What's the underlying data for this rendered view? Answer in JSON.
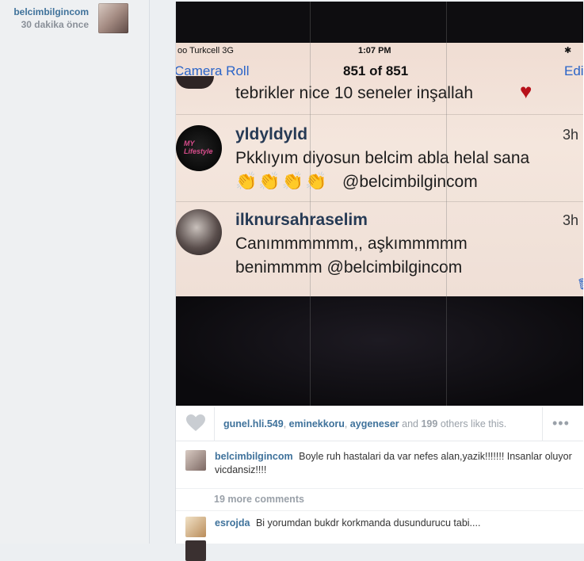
{
  "author": {
    "username": "belcimbilgincom",
    "time_ago": "30 dakika önce",
    "avatar_icon": "profile-photo"
  },
  "photo_screenshot": {
    "status": {
      "carrier": "oo Turkcell  3G",
      "time": "1:07 PM",
      "bluetooth_icon": "bluetooth-icon"
    },
    "nav": {
      "back_label": "Camera Roll",
      "title": "851 of 851",
      "edit_label": "Edi"
    },
    "comment_top_text": "tebrikler nice 10 seneler inşallah",
    "comments": [
      {
        "username": "yldyldyld",
        "time": "3h",
        "line1": "Pkklıyım diyosun belcim abla helal sana",
        "line2": "@belcimbilgincom",
        "avatar_text": "MY Lifestyle"
      },
      {
        "username": "ilknursahraselim",
        "time": "3h",
        "line1": "Canımmmmmm,, aşkımmmmm",
        "line2": "benimmmm  @belcimbilgincom"
      }
    ]
  },
  "likes": {
    "user1": "gunel.hli.549",
    "user2": "eminekkoru",
    "user3": "aygeneser",
    "connector": "and",
    "count": "199",
    "suffix": "others like this."
  },
  "more_label": "•••",
  "caption": {
    "username": "belcimbilgincom",
    "text": "Boyle ruh hastalari da var nefes alan,yazik!!!!!!! Insanlar oluyor vicdansiz!!!!"
  },
  "more_comments_label": "19 more comments",
  "comment": {
    "username": "esrojda",
    "text": "Bi yorumdan bukdr korkmanda dusundurucu tabi...."
  },
  "colors": {
    "link_blue": "#3f729b",
    "heart_red": "#b7111a",
    "muted_gray": "#9aa1a9"
  }
}
